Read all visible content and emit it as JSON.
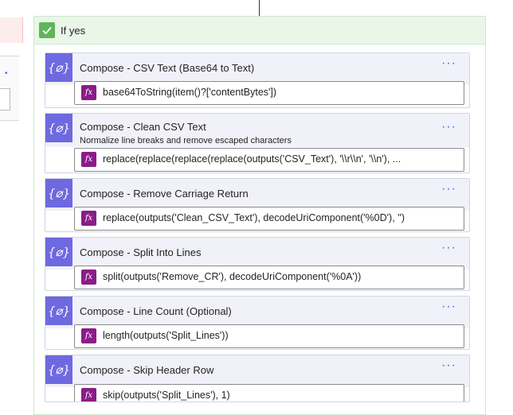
{
  "scope": {
    "title": "If yes"
  },
  "actions": [
    {
      "title": "Compose - CSV Text (Base64 to Text)",
      "subtitle": "",
      "expression": "base64ToString(item()?['contentBytes'])"
    },
    {
      "title": "Compose - Clean CSV Text",
      "subtitle": "Normalize line breaks and remove escaped characters",
      "expression": "replace(replace(replace(replace(outputs('CSV_Text'), '\\\\r\\\\n', '\\\\n'), ..."
    },
    {
      "title": "Compose - Remove Carriage Return",
      "subtitle": "",
      "expression": "replace(outputs('Clean_CSV_Text'), decodeUriComponent('%0D'), '')"
    },
    {
      "title": "Compose - Split Into Lines",
      "subtitle": "",
      "expression": "split(outputs('Remove_CR'), decodeUriComponent('%0A'))"
    },
    {
      "title": "Compose - Line Count (Optional)",
      "subtitle": "",
      "expression": "length(outputs('Split_Lines'))"
    },
    {
      "title": "Compose - Skip Header Row",
      "subtitle": "",
      "expression": "skip(outputs('Split_Lines'), 1)"
    }
  ],
  "icons": {
    "compose": "compose-braces-icon",
    "expression": "fx-expression-icon",
    "more": "more-options-icon",
    "check": "checkmark-icon"
  },
  "colors": {
    "compose": "#6f69e0",
    "fx": "#8a1c8a",
    "scope_header": "#eaf6e8",
    "check": "#5fb55a",
    "link": "#2b78d6"
  },
  "glyphs": {
    "braces": "{⌀}",
    "fx": "fx",
    "more": "···"
  }
}
